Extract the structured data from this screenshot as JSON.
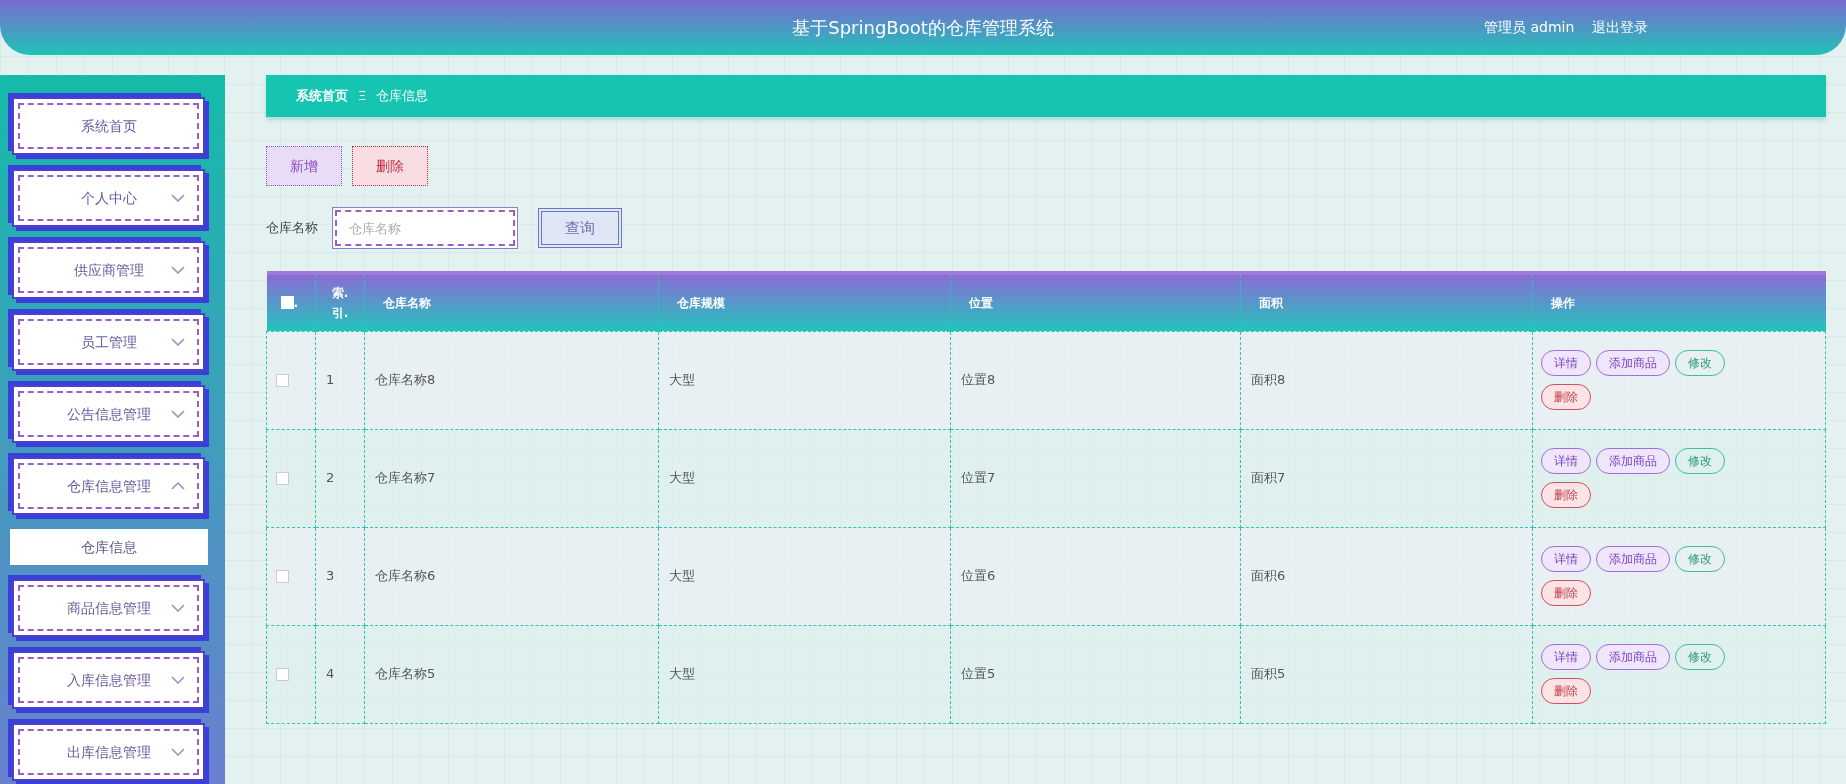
{
  "header": {
    "title": "基于SpringBoot的仓库管理系统",
    "user": "管理员 admin",
    "logout": "退出登录"
  },
  "sidebar": {
    "items": [
      {
        "label": "系统首页",
        "kind": "link"
      },
      {
        "label": "个人中心",
        "kind": "menu",
        "expanded": false
      },
      {
        "label": "供应商管理",
        "kind": "menu",
        "expanded": false
      },
      {
        "label": "员工管理",
        "kind": "menu",
        "expanded": false
      },
      {
        "label": "公告信息管理",
        "kind": "menu",
        "expanded": false
      },
      {
        "label": "仓库信息管理",
        "kind": "menu",
        "expanded": true,
        "children": [
          {
            "label": "仓库信息"
          }
        ]
      },
      {
        "label": "商品信息管理",
        "kind": "menu",
        "expanded": false
      },
      {
        "label": "入库信息管理",
        "kind": "menu",
        "expanded": false
      },
      {
        "label": "出库信息管理",
        "kind": "menu",
        "expanded": false
      }
    ]
  },
  "breadcrumb": {
    "items": [
      "系统首页",
      "仓库信息"
    ],
    "separator": "Ξ"
  },
  "toolbar": {
    "buttons": [
      {
        "label": "新增",
        "kind": "add"
      },
      {
        "label": "删除",
        "kind": "delete"
      }
    ]
  },
  "search": {
    "label": "仓库名称",
    "placeholder": "仓库名称",
    "button": "查询"
  },
  "table": {
    "select_all_checked": false,
    "select_all_suffix": ".",
    "columns": [
      "索.引.",
      "仓库名称",
      "仓库规模",
      "位置",
      "面积",
      "操作"
    ],
    "rows": [
      {
        "checked": false,
        "index": "1",
        "name": "仓库名称8",
        "scale": "大型",
        "location": "位置8",
        "area": "面积8",
        "actions": [
          {
            "label": "详情",
            "kind": "detail"
          },
          {
            "label": "添加商品",
            "kind": "add"
          },
          {
            "label": "修改",
            "kind": "edit"
          },
          {
            "label": "删除",
            "kind": "delete"
          }
        ]
      },
      {
        "checked": false,
        "index": "2",
        "name": "仓库名称7",
        "scale": "大型",
        "location": "位置7",
        "area": "面积7",
        "actions": [
          {
            "label": "详情",
            "kind": "detail"
          },
          {
            "label": "添加商品",
            "kind": "add"
          },
          {
            "label": "修改",
            "kind": "edit"
          },
          {
            "label": "删除",
            "kind": "delete"
          }
        ]
      },
      {
        "checked": false,
        "index": "3",
        "name": "仓库名称6",
        "scale": "大型",
        "location": "位置6",
        "area": "面积6",
        "actions": [
          {
            "label": "详情",
            "kind": "detail"
          },
          {
            "label": "添加商品",
            "kind": "add"
          },
          {
            "label": "修改",
            "kind": "edit"
          },
          {
            "label": "删除",
            "kind": "delete"
          }
        ]
      },
      {
        "checked": false,
        "index": "4",
        "name": "仓库名称5",
        "scale": "大型",
        "location": "位置5",
        "area": "面积5",
        "actions": [
          {
            "label": "详情",
            "kind": "detail"
          },
          {
            "label": "添加商品",
            "kind": "add"
          },
          {
            "label": "修改",
            "kind": "edit"
          },
          {
            "label": "删除",
            "kind": "delete"
          }
        ]
      }
    ]
  }
}
